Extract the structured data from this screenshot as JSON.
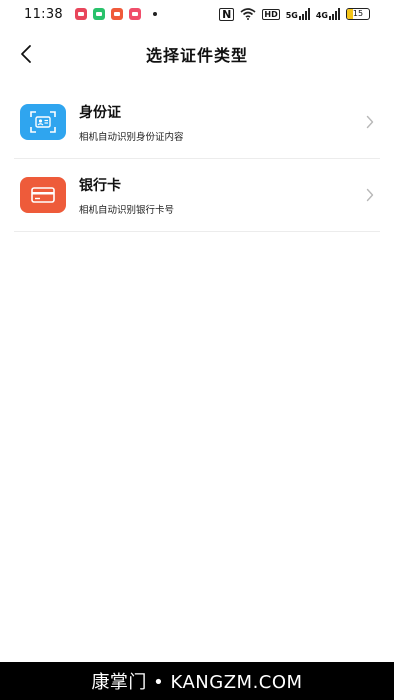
{
  "status_bar": {
    "time": "11:38",
    "hd_label": "HD",
    "signal_labels": [
      "5G",
      "4G"
    ],
    "battery_level": "15",
    "app_icons": [
      {
        "name": "app-icon-1",
        "color": "#e8465b"
      },
      {
        "name": "app-icon-2",
        "color": "#29c26b"
      },
      {
        "name": "app-icon-3",
        "color": "#f05a3a"
      },
      {
        "name": "app-icon-4",
        "color": "#f04e6b"
      }
    ]
  },
  "header": {
    "title": "选择证件类型",
    "back_icon": "chevron-left-icon"
  },
  "document_types": [
    {
      "label": "身份证",
      "description": "相机自动识别身份证内容",
      "icon": "id-card-scan-icon",
      "icon_bg": "#2fa5ef"
    },
    {
      "label": "银行卡",
      "description": "相机自动识别银行卡号",
      "icon": "bank-card-icon",
      "icon_bg": "#ee5b3a"
    }
  ],
  "watermark": "康掌门 • KANGZM.COM"
}
